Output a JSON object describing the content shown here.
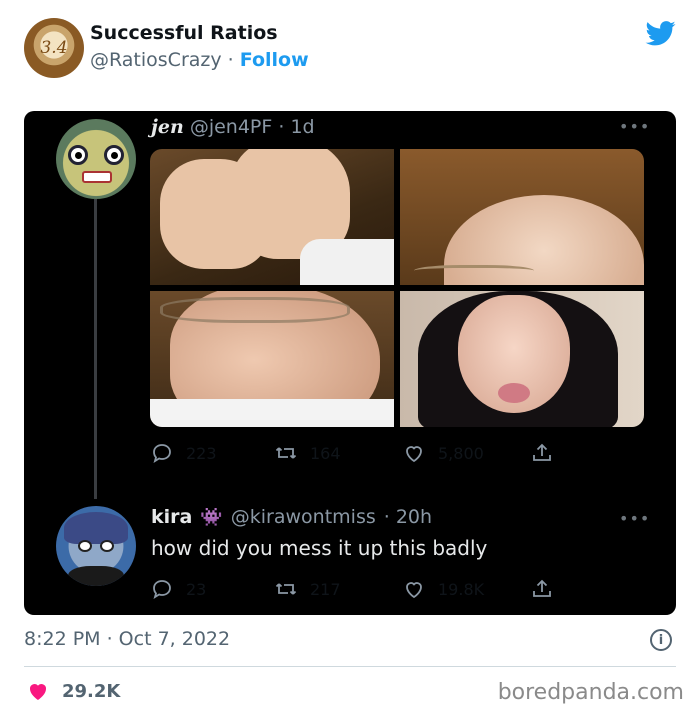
{
  "author": {
    "avatar_text": "3.4",
    "display_name": "Successful Ratios",
    "handle": "@RatiosCrazy",
    "separator": "·",
    "follow_label": "Follow"
  },
  "embedded": {
    "tweet1": {
      "name": "jen",
      "handle": "@jen4PF",
      "age": "· 1d",
      "more": "•••",
      "replies": "223",
      "retweets": "164",
      "likes": "5,800"
    },
    "tweet2": {
      "name": "kira",
      "badge_icon": "👾",
      "handle": "@kirawontmiss",
      "age": "· 20h",
      "more": "•••",
      "text": "how did you mess it up this badly",
      "replies": "23",
      "retweets": "217",
      "likes": "19.8K"
    }
  },
  "footer": {
    "timestamp": "8:22 PM · Oct 7, 2022",
    "info_icon": "i",
    "like_count": "29.2K",
    "watermark": "boredpanda.com"
  },
  "colors": {
    "accent": "#1d9bf0",
    "heart": "#f91880",
    "dark_bg": "#000000"
  },
  "icons": [
    "twitter-bird-icon",
    "info-icon",
    "heart-icon",
    "reply-icon",
    "retweet-icon",
    "like-icon",
    "share-icon",
    "more-icon"
  ]
}
